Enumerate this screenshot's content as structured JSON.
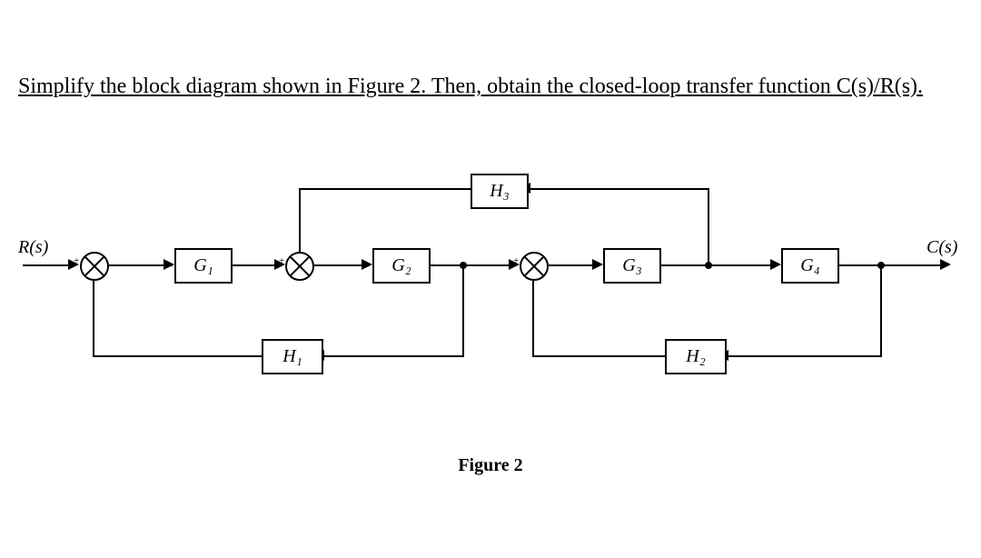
{
  "prompt_text": "Simplify the block diagram shown in Figure 2. Then, obtain the closed-loop transfer function C(s)/R(s).",
  "input_label": "R(s)",
  "output_label": "C(s)",
  "blocks": {
    "g1": "G₁",
    "g2": "G₂",
    "g3": "G₃",
    "g4": "G₄",
    "h1": "H₁",
    "h2": "H₂",
    "h3": "H₃"
  },
  "caption": "Figure 2",
  "diagram_description": {
    "type": "control-system-block-diagram",
    "forward_path": [
      "R(s)",
      "sum1",
      "G1",
      "sum2",
      "G2",
      "sum3",
      "G3",
      "G4",
      "C(s)"
    ],
    "feedback_loops": [
      {
        "from_after": "G2",
        "through": "H1",
        "to": "sum1",
        "sign": "feedback"
      },
      {
        "from_after": "G4",
        "through": "H2",
        "to": "sum3",
        "sign": "feedback"
      },
      {
        "from_after": "G3_G4_branch",
        "through": "H3",
        "to": "sum2",
        "sign": "feedforward_reverse"
      }
    ],
    "summing_junctions": [
      "sum1",
      "sum2",
      "sum3"
    ]
  }
}
